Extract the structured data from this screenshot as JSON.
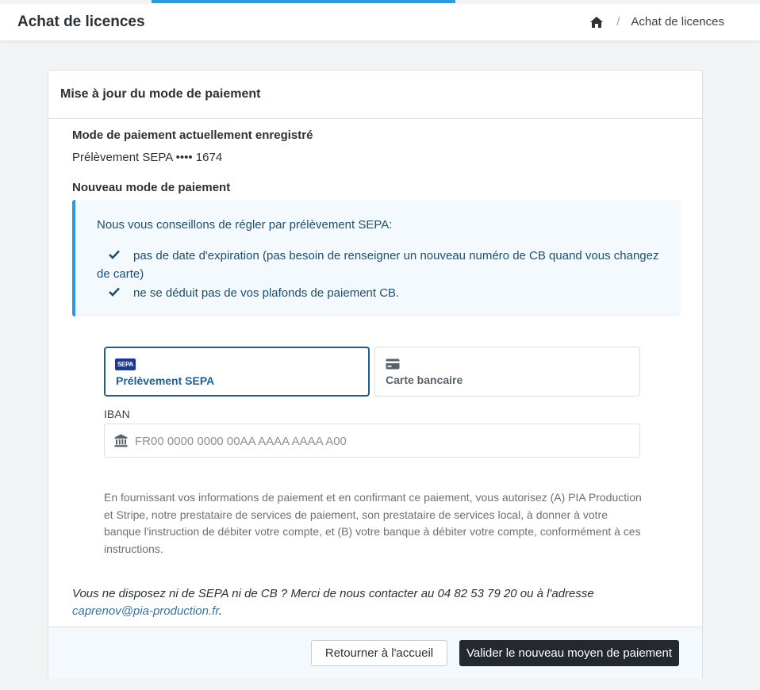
{
  "header": {
    "title": "Achat de licences",
    "breadcrumb": {
      "home_icon": "home-icon",
      "separator": "/",
      "current": "Achat de licences"
    }
  },
  "card": {
    "title": "Mise à jour du mode de paiement",
    "current_method": {
      "heading": "Mode de paiement actuellement enregistré",
      "value": "Prélèvement SEPA •••• 1674"
    },
    "new_method": {
      "heading": "Nouveau mode de paiement"
    },
    "notice": {
      "intro": "Nous vous conseillons de régler par prélèvement SEPA:",
      "items": [
        "pas de date d'expiration (pas besoin de renseigner un nouveau numéro de CB quand vous changez de carte)",
        "ne se déduit pas de vos plafonds de paiement CB."
      ]
    },
    "payment_methods": [
      {
        "label": "Prélèvement SEPA",
        "icon": "sepa-logo-icon",
        "logo_text": "SEPA",
        "selected": true
      },
      {
        "label": "Carte bancaire",
        "icon": "credit-card-icon",
        "selected": false
      }
    ],
    "iban": {
      "label": "IBAN",
      "placeholder": "FR00 0000 0000 00AA AAAA AAAA A00",
      "value": "",
      "icon": "bank-icon"
    },
    "legal_text": "En fournissant vos informations de paiement et en confirmant ce paiement, vous autorisez (A) PIA Production et Stripe, notre prestataire de services de paiement, son prestataire de services local, à donner à votre banque l'instruction de débiter votre compte, et (B) votre banque à débiter votre compte, conformément à ces instructions.",
    "contact": {
      "text": "Vous ne disposez ni de SEPA ni de CB ? Merci de nous contacter au 04 82 53 79 20 ou à l'adresse ",
      "email": "caprenov@pia-production.fr",
      "suffix": "."
    },
    "footer": {
      "back_label": "Retourner à l'accueil",
      "submit_label": "Valider le nouveau moyen de paiement"
    }
  },
  "colors": {
    "accent": "#2a9be2",
    "selected_border": "#1d5f93",
    "notice_bg": "#f3f9fd",
    "primary_button": "#23292f"
  }
}
